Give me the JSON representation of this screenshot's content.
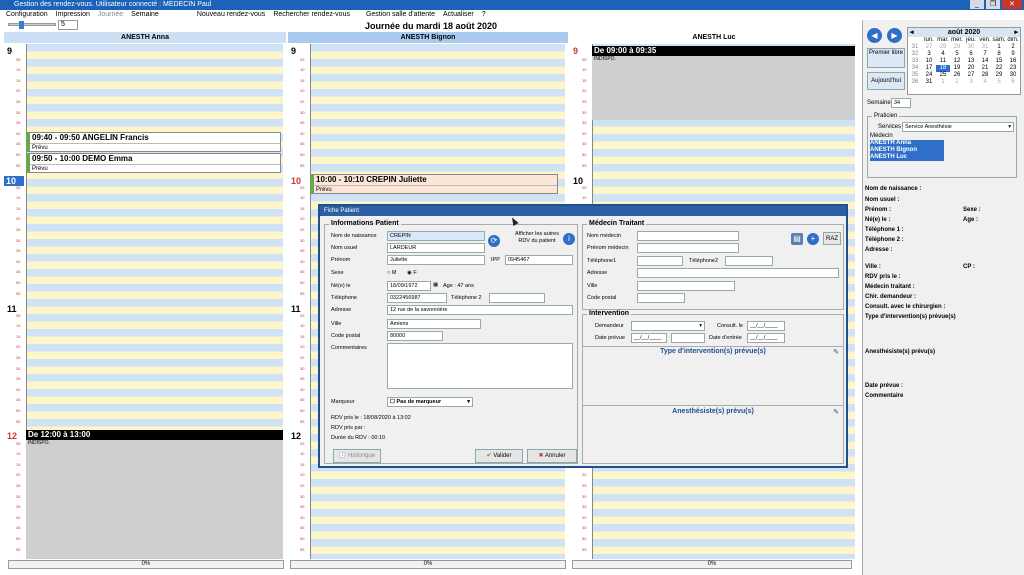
{
  "window": {
    "title": "Gestion des rendez-vous.  Utilisateur connecté : MEDECIN Paul"
  },
  "menu": {
    "items": [
      "Configuration",
      "Impression",
      "Journée",
      "Semaine",
      "Nouveau rendez-vous",
      "Rechercher rendez-vous",
      "Gestion salle d'attente",
      "Actualiser",
      "?"
    ]
  },
  "toolbar": {
    "zoom": "5"
  },
  "day_title": "Journée du mardi 18 août 2020",
  "columns": [
    {
      "name": "ANESTH Anna",
      "hours": [
        {
          "h": "9",
          "m": ""
        },
        {
          "h": "10",
          "m": "00"
        },
        {
          "h": "11",
          "m": ""
        },
        {
          "h": "12",
          "m": ""
        }
      ],
      "progress": "0%"
    },
    {
      "name": "ANESTH Bignon",
      "hours": [
        {
          "h": "9",
          "m": ""
        },
        {
          "h": "10",
          "m": "00"
        },
        {
          "h": "11",
          "m": ""
        },
        {
          "h": "12",
          "m": ""
        }
      ],
      "progress": "0%"
    },
    {
      "name": "ANESTH Luc",
      "hours": [
        {
          "h": "9",
          "m": "00"
        },
        {
          "h": "10",
          "m": ""
        },
        {
          "h": "11",
          "m": ""
        },
        {
          "h": "12",
          "m": ""
        }
      ],
      "progress": "0%"
    }
  ],
  "minute_ticks": [
    "05",
    "10",
    "15",
    "20",
    "25",
    "30",
    "35",
    "40",
    "45",
    "50",
    "55"
  ],
  "appointments": {
    "a1": {
      "title": "09:40 - 09:50 ANGELIN Francis",
      "status": "Prévu"
    },
    "a2": {
      "title": "09:50 - 10:00 DEMO Emma",
      "status": "Prévu"
    },
    "b1": {
      "title": "10:00 - 10:10 CREPIN Juliette",
      "status": "Prévu"
    },
    "c_block": {
      "title": "De 09:00 à 09:35",
      "sub": "INDISPO."
    },
    "a_block": {
      "title": "De 12:00 à 13:00",
      "sub": "INDISPO."
    }
  },
  "calendar": {
    "month": "août 2020",
    "days_header": [
      "lun.",
      "mar.",
      "mer.",
      "jeu.",
      "ven.",
      "sam.",
      "dim."
    ],
    "weeks": [
      {
        "w": "31",
        "d": [
          "27",
          "28",
          "29",
          "30",
          "31",
          "1",
          "2"
        ]
      },
      {
        "w": "32",
        "d": [
          "3",
          "4",
          "5",
          "6",
          "7",
          "8",
          "9"
        ]
      },
      {
        "w": "33",
        "d": [
          "10",
          "11",
          "12",
          "13",
          "14",
          "15",
          "16"
        ]
      },
      {
        "w": "34",
        "d": [
          "17",
          "18",
          "19",
          "20",
          "21",
          "22",
          "23"
        ]
      },
      {
        "w": "35",
        "d": [
          "24",
          "25",
          "26",
          "27",
          "28",
          "29",
          "30"
        ]
      },
      {
        "w": "36",
        "d": [
          "31",
          "1",
          "2",
          "3",
          "4",
          "5",
          "6"
        ]
      }
    ],
    "selected": "18"
  },
  "right": {
    "premier_libre": "Premier libre",
    "aujourdhui": "Aujourd'hui",
    "semaine_label": "Semaine",
    "semaine_val": "34",
    "praticien_legend": "Praticien",
    "services_label": "Services",
    "services_val": "Service Anesthésie",
    "medecin_label": "Médecin",
    "medecins": [
      "ANESTH Anna",
      "ANESTH Bignon",
      "ANESTH Luc"
    ],
    "info": [
      "Nom de naissance :",
      "Nom usuel :",
      "Prénom :",
      "Sexe :",
      "Né(e) le :",
      "Age :",
      "Téléphone 1 :",
      "Téléphone 2 :",
      "Adresse :",
      "Ville :",
      "CP :",
      "RDV pris le :",
      "Médecin traitant :",
      "Chir. demandeur :",
      "Consult. avec le chirurgien :",
      "Type d'intervention(s) prévue(s)",
      "Anesthésiste(s) prévu(s)",
      "Date prévue :",
      "Commentaire"
    ]
  },
  "modal": {
    "title": "Fiche Patient",
    "info_legend": "Informations Patient",
    "labels": {
      "nom_naissance": "Nom de naissance",
      "nom_usuel": "Nom usuel",
      "prenom": "Prénom",
      "ipp": "IPP",
      "sexe": "Sexe",
      "m": "M",
      "f": "F",
      "ne_le": "Né(e) le",
      "age": "Age : 47 ans",
      "tel": "Téléphone",
      "tel2": "Téléphone 2",
      "adresse": "Adresse",
      "ville": "Ville",
      "cp": "Code postal",
      "commentaires": "Commentaires",
      "marqueur": "Marqueur",
      "autres_rdv": "Afficher les autres RDV du patient"
    },
    "values": {
      "nom_naissance": "CREPIN",
      "nom_usuel": "LARDEUR",
      "prenom": "Juliette",
      "ipp": "0945467",
      "ne_le": "18/09/1972",
      "tel": "0322456987",
      "tel2": "",
      "adresse": "12 rue de la savonnière",
      "ville": "Amiens",
      "cp": "80000",
      "marqueur": "Pas de marqueur"
    },
    "rdv_pris_le": "RDV pris le :  18/08/2020 à 13:02",
    "rdv_pris_par": "RDV pris par :",
    "duree": "Durée du RDV :  00:10",
    "historique": "Historique",
    "valider": "Valider",
    "annuler": "Annuler",
    "medecin_legend": "Médecin Traitant",
    "med_labels": {
      "nom": "Nom médecin",
      "prenom": "Prénom médecin",
      "tel1": "Téléphone1",
      "tel2": "Téléphone2",
      "adresse": "Adresse",
      "ville": "Ville",
      "cp": "Code postal"
    },
    "raz": "RAZ",
    "intervention_legend": "Intervention",
    "int_labels": {
      "demandeur": "Demandeur",
      "consult": "Consult. le",
      "date_prevue": "Date prévue",
      "date_entree": "Date d'entrée"
    },
    "date_placeholder": "__/__/____",
    "type_int": "Type d'intervention(s) prévue(s)",
    "anesth": "Anesthésiste(s) prévu(s)"
  }
}
